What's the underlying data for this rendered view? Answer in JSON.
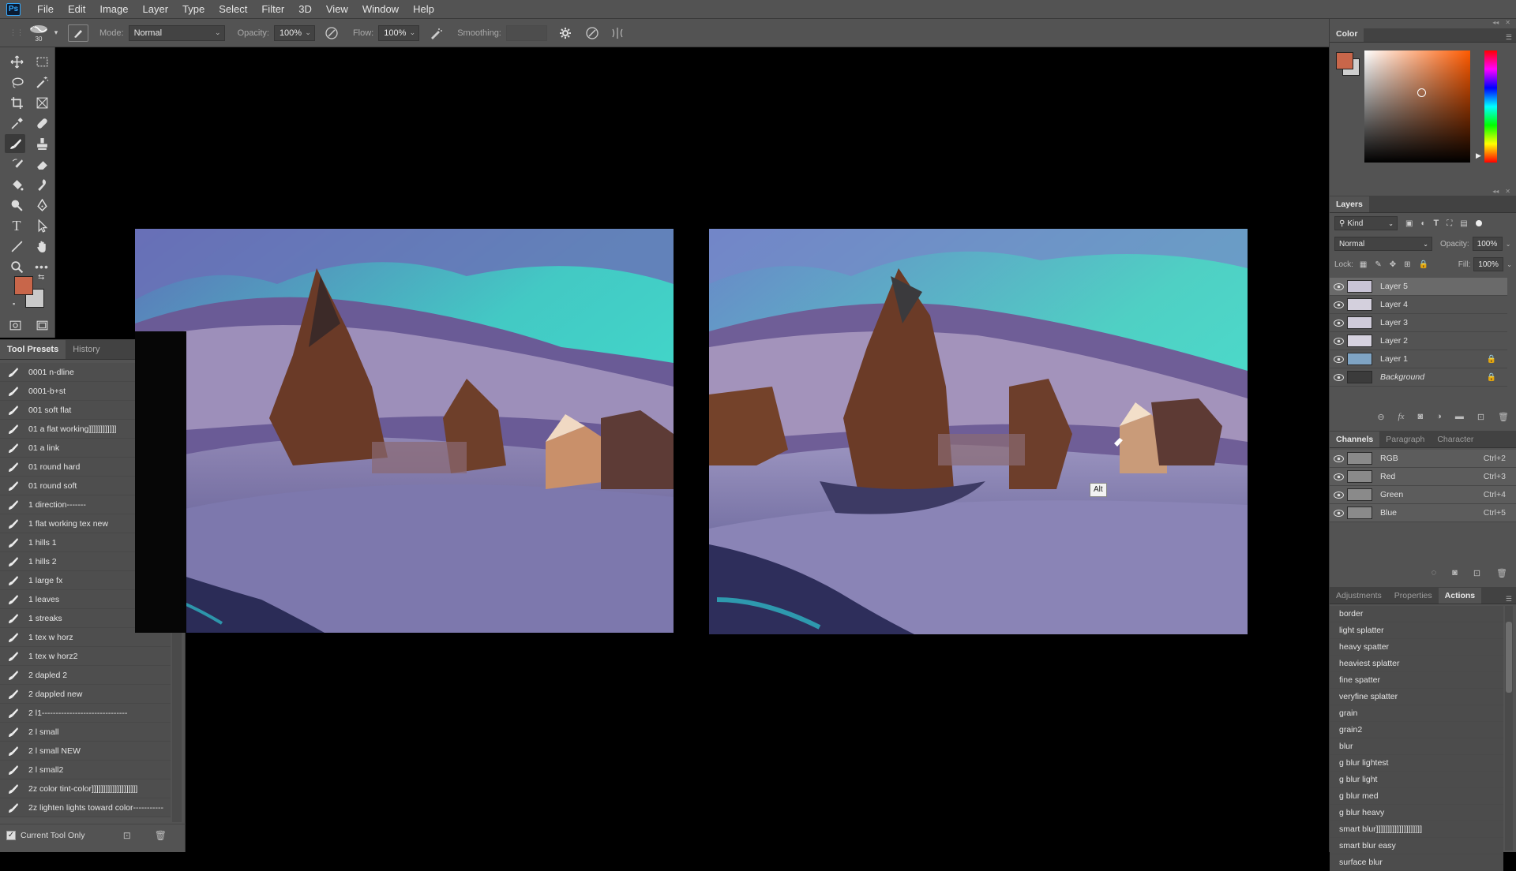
{
  "app": {
    "logo": "Ps"
  },
  "menu": [
    "File",
    "Edit",
    "Image",
    "Layer",
    "Type",
    "Select",
    "Filter",
    "3D",
    "View",
    "Window",
    "Help"
  ],
  "options": {
    "brush_size": "30",
    "mode_label": "Mode:",
    "mode_value": "Normal",
    "opacity_label": "Opacity:",
    "opacity_value": "100%",
    "flow_label": "Flow:",
    "flow_value": "100%",
    "smoothing_label": "Smoothing:",
    "smoothing_value": ""
  },
  "colors": {
    "foreground": "#c8664a",
    "background": "#c9c9c9",
    "ui_panel": "#535353",
    "ui_dark": "#424242"
  },
  "tool_presets": {
    "tabs": [
      "Tool Presets",
      "History"
    ],
    "items": [
      "0001 n-dline",
      "0001-b+st",
      "001 soft flat",
      "01 a flat working]]]]]]]]]]]]",
      "01 a link",
      "01 round hard",
      "01 round soft",
      "1 direction-------",
      "1 flat working tex new",
      "1 hills 1",
      "1 hills 2",
      "1 large fx",
      "1 leaves",
      "1 streaks",
      "1 tex w horz",
      "1 tex w horz2",
      "2 dapled 2",
      "2 dappled new",
      "2 l1-------------------------------",
      "2 l small",
      "2 l small NEW",
      "2 l small2",
      "2z color tint-color]]]]]]]]]]]]]]]]]]]]",
      "2z lighten lights toward color-----------"
    ],
    "footer_label": "Current Tool Only"
  },
  "color_panel": {
    "tab": "Color"
  },
  "layers_panel": {
    "tab": "Layers",
    "kind_label": "Kind",
    "blend_mode": "Normal",
    "opacity_label": "Opacity:",
    "opacity_value": "100%",
    "lock_label": "Lock:",
    "fill_label": "Fill:",
    "fill_value": "100%",
    "layers": [
      {
        "name": "Layer 5",
        "locked": false,
        "selected": true
      },
      {
        "name": "Layer 4",
        "locked": false,
        "selected": false
      },
      {
        "name": "Layer 3",
        "locked": false,
        "selected": false
      },
      {
        "name": "Layer 2",
        "locked": false,
        "selected": false
      },
      {
        "name": "Layer 1",
        "locked": true,
        "selected": false
      },
      {
        "name": "Background",
        "locked": true,
        "selected": false
      }
    ]
  },
  "channels_panel": {
    "tabs": [
      "Channels",
      "Paragraph",
      "Character"
    ],
    "channels": [
      {
        "name": "RGB",
        "shortcut": "Ctrl+2"
      },
      {
        "name": "Red",
        "shortcut": "Ctrl+3"
      },
      {
        "name": "Green",
        "shortcut": "Ctrl+4"
      },
      {
        "name": "Blue",
        "shortcut": "Ctrl+5"
      }
    ]
  },
  "actions_panel": {
    "tabs": [
      "Adjustments",
      "Properties",
      "Actions"
    ],
    "items": [
      "border",
      "light splatter",
      "heavy spatter",
      "heaviest splatter",
      "fine spatter",
      "veryfine splatter",
      "grain",
      "grain2",
      "blur",
      "g blur lightest",
      "g blur light",
      "g blur med",
      "g blur heavy",
      "smart blur]]]]]]]]]]]]]]]]]]]]",
      "smart blur easy",
      "surface blur"
    ]
  },
  "canvas": {
    "tooltip": "Alt"
  }
}
